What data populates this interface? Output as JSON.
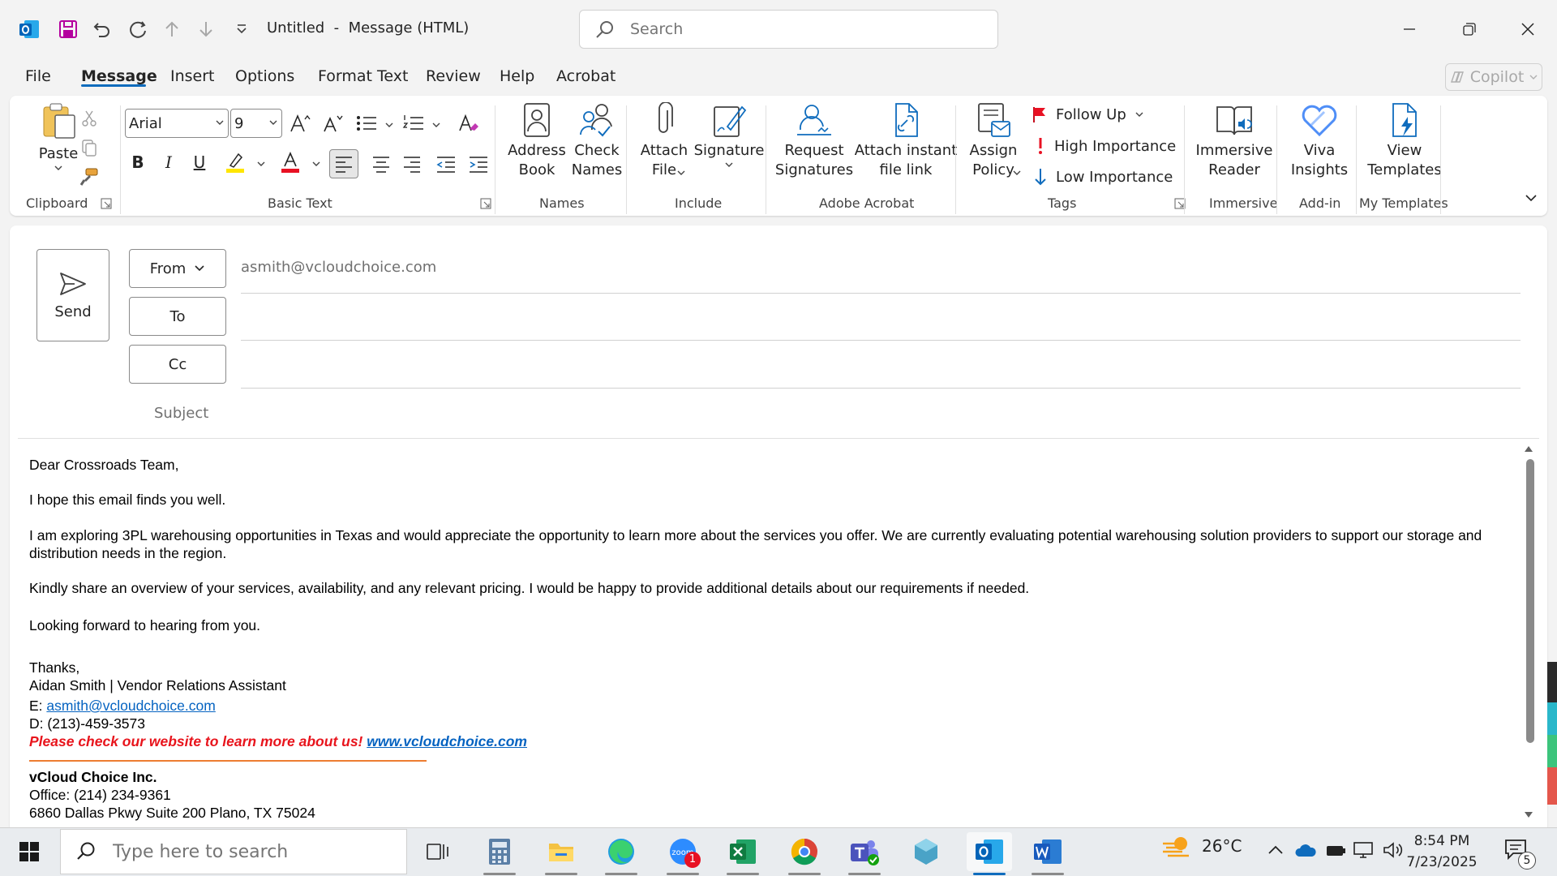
{
  "window": {
    "title": "Untitled  -  Message (HTML)",
    "search_placeholder": "Search"
  },
  "menu": {
    "tabs": [
      "File",
      "Message",
      "Insert",
      "Options",
      "Format Text",
      "Review",
      "Help",
      "Acrobat"
    ],
    "active": "Message",
    "copilot_label": "Copilot"
  },
  "ribbon": {
    "clipboard": {
      "paste": "Paste",
      "label": "Clipboard"
    },
    "basic_text": {
      "font": "Arial",
      "size": "9",
      "label": "Basic Text"
    },
    "names": {
      "address_book": "Address\nBook",
      "check_names": "Check\nNames",
      "label": "Names"
    },
    "include": {
      "attach_file": "Attach\nFile",
      "signature": "Signature",
      "label": "Include"
    },
    "adobe": {
      "request_signatures": "Request\nSignatures",
      "attach_link": "Attach instant\nfile link",
      "label": "Adobe Acrobat"
    },
    "tags": {
      "assign_policy": "Assign\nPolicy",
      "follow_up": "Follow Up",
      "high_importance": "High Importance",
      "low_importance": "Low Importance",
      "label": "Tags"
    },
    "immersive": {
      "reader": "Immersive\nReader",
      "label": "Immersive"
    },
    "addin": {
      "viva": "Viva\nInsights",
      "label": "Add-in"
    },
    "templates": {
      "view": "View\nTemplates",
      "label": "My Templates"
    }
  },
  "compose": {
    "send_label": "Send",
    "from_label": "From",
    "to_label": "To",
    "cc_label": "Cc",
    "subject_label": "Subject",
    "from_value": "asmith@vcloudchoice.com"
  },
  "body": {
    "greeting": "Dear Crossroads Team,",
    "line1": "I hope this email finds you well.",
    "para1": "I am exploring 3PL warehousing opportunities in Texas and would appreciate the opportunity to learn more about the services you offer. We are currently evaluating potential warehousing solution providers to support our storage and distribution needs in the region.",
    "para2": "Kindly share an overview of your services, availability, and any relevant pricing. I would be happy to provide additional details about our requirements if needed.",
    "closing_line": "Looking forward to hearing from you.",
    "thanks": "Thanks,",
    "sig_name": "Aidan Smith | Vendor Relations Assistant",
    "email_prefix": "E: ",
    "email": "asmith@vcloudchoice.com",
    "direct": "D: (213)-459-3573",
    "promo_text": "Please check our website to learn more about us! ",
    "website": "www.vcloudchoice.com",
    "company": "vCloud Choice Inc.",
    "office": "Office: (214) 234-9361",
    "address": "6860 Dallas Pkwy Suite 200 Plano, TX 75024"
  },
  "taskbar": {
    "search_placeholder": "Type here to search",
    "temperature": "26°C",
    "time": "8:54 PM",
    "date": "7/23/2025",
    "zoom_badge": "1",
    "notification_count": "5"
  },
  "colors": {
    "accent": "#0f6cbd",
    "promo_red": "#e8141c",
    "link_blue": "#0563c1",
    "rule_orange": "#ed7d31"
  }
}
